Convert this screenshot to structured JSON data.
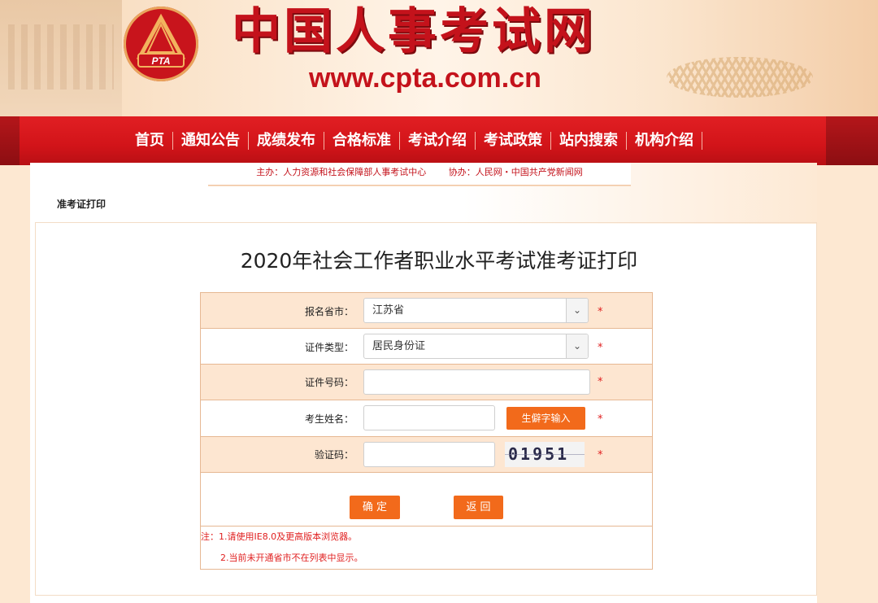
{
  "site": {
    "title": "中国人事考试网",
    "url": "www.cpta.com.cn",
    "logo_text": "PTA"
  },
  "nav": {
    "items": [
      {
        "label": "首页"
      },
      {
        "label": "通知公告"
      },
      {
        "label": "成绩发布"
      },
      {
        "label": "合格标准"
      },
      {
        "label": "考试介绍"
      },
      {
        "label": "考试政策"
      },
      {
        "label": "站内搜索"
      },
      {
        "label": "机构介绍"
      }
    ]
  },
  "sponsor": {
    "host": "主办：人力资源和社会保障部人事考试中心",
    "co_host": "协办：人民网・中国共产党新闻网"
  },
  "breadcrumb": "准考证打印",
  "page_title": "2020年社会工作者职业水平考试准考证打印",
  "form": {
    "province": {
      "label": "报名省市：",
      "value": "江苏省"
    },
    "id_type": {
      "label": "证件类型：",
      "value": "居民身份证"
    },
    "id_number": {
      "label": "证件号码：",
      "value": ""
    },
    "name": {
      "label": "考生姓名：",
      "value": "",
      "rare_char_button": "生僻字输入"
    },
    "captcha": {
      "label": "验证码：",
      "value": "",
      "image_text": "01951"
    },
    "required_mark": "*",
    "confirm_button": "确 定",
    "back_button": "返 回",
    "note_1": "注：1.请使用IE8.0及更高版本浏览器。",
    "note_2": "2.当前未开通省市不在列表中显示。"
  },
  "colors": {
    "brand_red": "#c4121b",
    "nav_red": "#d21419",
    "button_orange": "#f26a1b",
    "row_shade": "#fde6d1"
  }
}
